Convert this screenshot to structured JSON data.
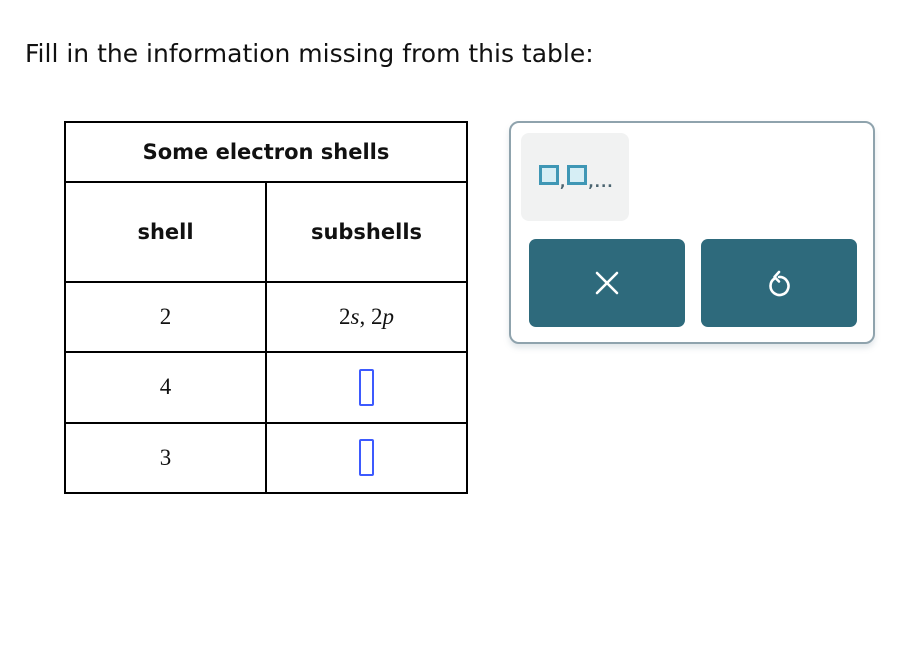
{
  "prompt": "Fill in the information missing from this table:",
  "table": {
    "caption": "Some electron shells",
    "headers": {
      "shell": "shell",
      "subshells": "subshells"
    },
    "rows": [
      {
        "shell": "2",
        "subshells": {
          "type": "text",
          "parts": [
            "2",
            "s",
            ", 2",
            "p"
          ]
        }
      },
      {
        "shell": "4",
        "subshells": {
          "type": "input",
          "value": ""
        }
      },
      {
        "shell": "3",
        "subshells": {
          "type": "input",
          "value": ""
        }
      }
    ]
  },
  "palette": {
    "template_button": {
      "icon": "list-template-icon",
      "separator": ",",
      "ellipsis": ",..."
    },
    "clear_button": {
      "icon": "close-icon",
      "label": "Clear"
    },
    "reset_button": {
      "icon": "undo-icon",
      "label": "Reset"
    }
  },
  "colors": {
    "button_bg": "#2e6a7c",
    "input_border": "#3d5afe",
    "palette_border": "#8fa3ad",
    "template_bg": "#f1f2f2",
    "template_box_border": "#3f97b5",
    "template_box_fill": "#d6eef5"
  }
}
